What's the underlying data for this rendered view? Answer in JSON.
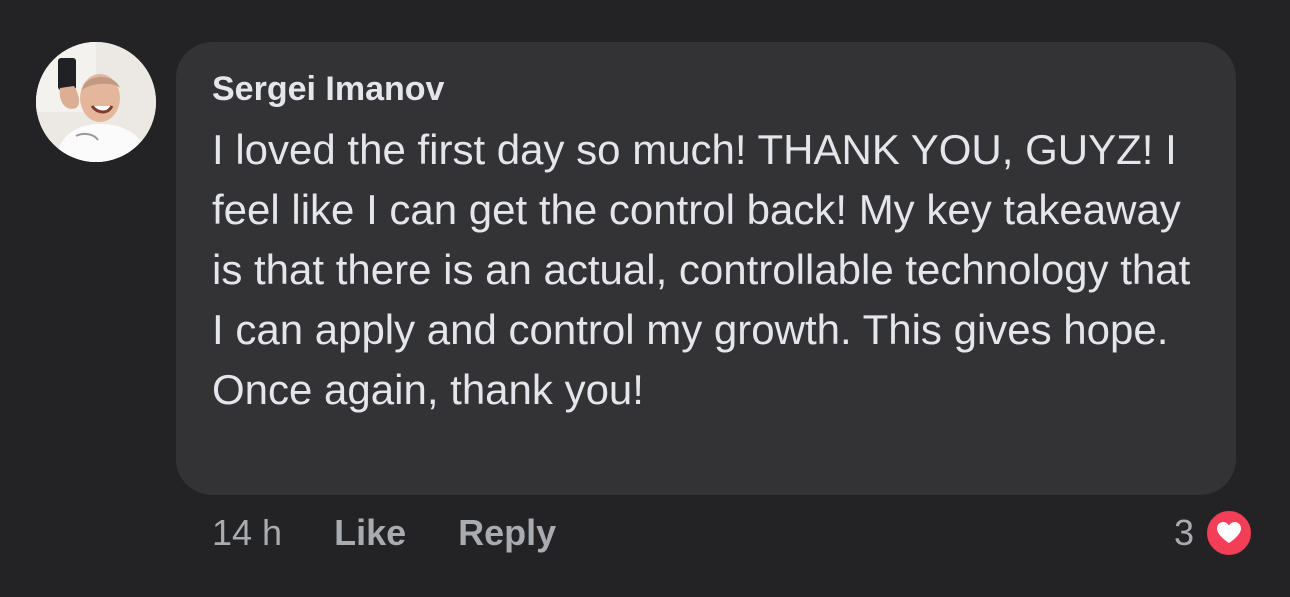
{
  "comment": {
    "author": "Sergei Imanov",
    "text": "I loved the first day so much! THANK YOU, GUYZ! I feel like I can get the control back! My key takeaway is that there is an actual, controllable technology that I can apply and control my growth. This gives hope. Once again, thank you!",
    "timestamp": "14 h",
    "like_label": "Like",
    "reply_label": "Reply",
    "reaction_count": "3",
    "reaction_icon": "heart-icon",
    "colors": {
      "background": "#232325",
      "bubble": "#333335",
      "text": "#e4e6eb",
      "muted": "#a8abb0",
      "heart": "#f33e58"
    }
  }
}
